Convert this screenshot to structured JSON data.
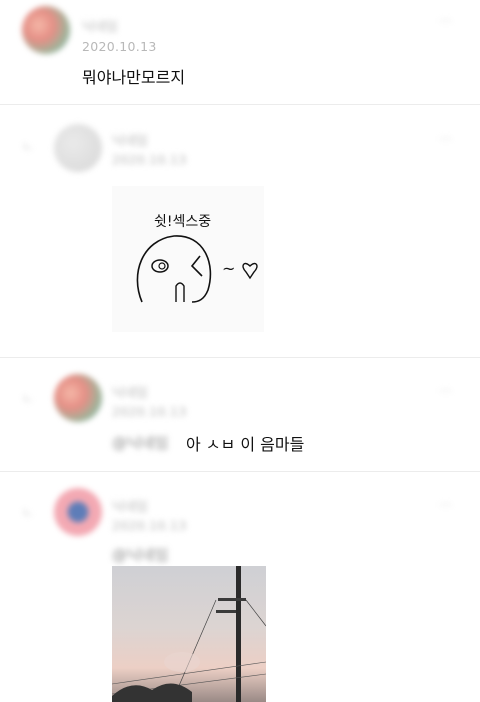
{
  "comments": [
    {
      "author": "닉네임",
      "date": "2020.10.13",
      "text": "뭐야나만모르지",
      "more": "···"
    },
    {
      "author": "닉네임",
      "date": "2020.10.13",
      "reply_marker": "ㄴ",
      "more": "···",
      "sticker_text": "쉿!섹스중",
      "sticker_suffix": "~"
    },
    {
      "author": "닉네임",
      "date": "2020.10.13",
      "reply_marker": "ㄴ",
      "mention": "@닉네임",
      "text": "아 ㅅㅂ 이 음마들",
      "more": "···"
    },
    {
      "author": "닉네임",
      "date": "2020.10.13",
      "reply_marker": "ㄴ",
      "mention": "@닉네임",
      "more": "···"
    }
  ]
}
